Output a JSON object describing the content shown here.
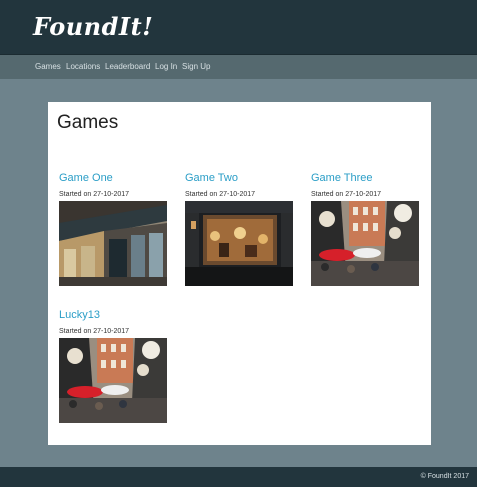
{
  "header": {
    "logo": "FoundIt!"
  },
  "nav": {
    "items": [
      "Games",
      "Locations",
      "Leaderboard",
      "Log In",
      "Sign Up"
    ]
  },
  "main": {
    "title": "Games",
    "games": [
      {
        "title": "Game One",
        "started": "Started on 27-10-2017"
      },
      {
        "title": "Game Two",
        "started": "Started on 27-10-2017"
      },
      {
        "title": "Game Three",
        "started": "Started on 27-10-2017"
      },
      {
        "title": "Lucky13",
        "started": "Started on 27-10-2017"
      }
    ]
  },
  "footer": {
    "copyright": "© FoundIt 2017"
  },
  "colors": {
    "header_bg": "#22353d",
    "nav_bg": "#55696f",
    "page_bg": "#6e838c",
    "link": "#2b9ec7"
  }
}
